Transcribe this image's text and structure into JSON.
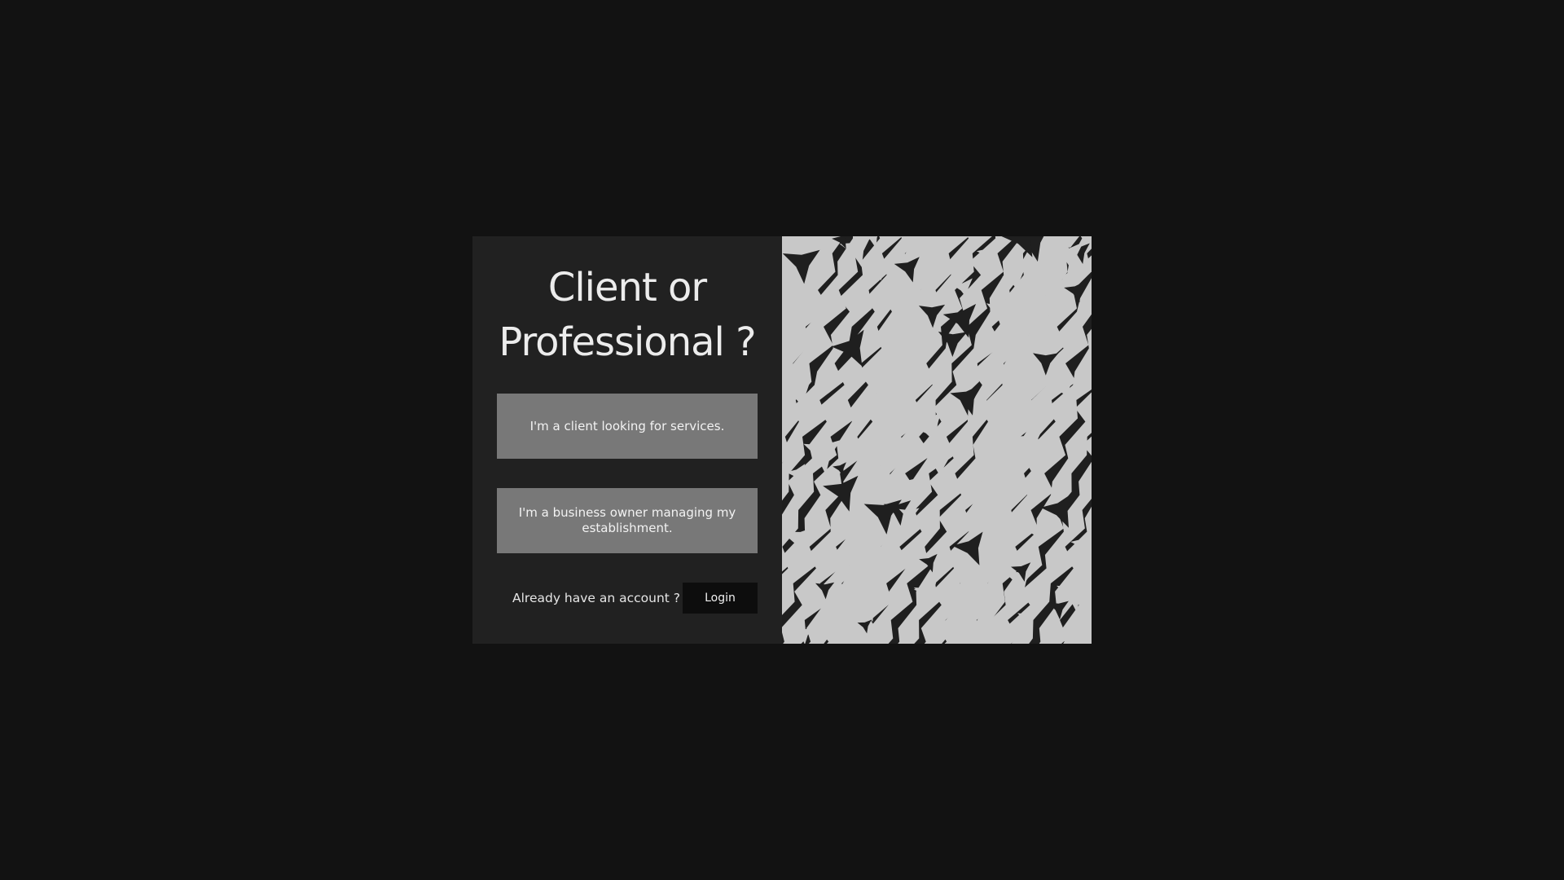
{
  "dialog": {
    "title_line1": "Client or",
    "title_line2": "Professional ?",
    "client_button_label": "I'm a client looking for services.",
    "business_button_label": "I'm a business owner managing my establishment.",
    "account_prompt": "Already have an account ?",
    "login_button_label": "Login"
  },
  "colors": {
    "page_background": "#121212",
    "panel_background": "#212121",
    "choice_button": "#787878",
    "login_button": "#0d0d0d",
    "pattern_light": "#c8c8c8",
    "pattern_dark": "#1f1f1f"
  }
}
